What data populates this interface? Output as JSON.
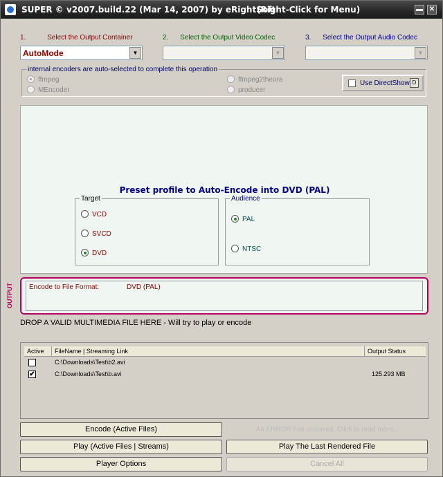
{
  "window": {
    "title": "SUPER © v2007.build.22 (Mar 14, 2007) by eRightSoft",
    "hint": "(Right-Click for Menu)"
  },
  "steps": [
    {
      "num": "1.",
      "label": "Select the Output Container",
      "color": "#8b0000"
    },
    {
      "num": "2.",
      "label": "Select the Output Video Codec",
      "color": "#006400"
    },
    {
      "num": "3.",
      "label": "Select the Output Audio Codec",
      "color": "#0000a0"
    }
  ],
  "containers": {
    "container_value": "AutoMode",
    "video_value": "",
    "audio_value": ""
  },
  "encoders": {
    "legend": "internal encoders are auto-selected to complete this operation",
    "options": [
      "ffmpeg",
      "MEncoder",
      "ffmpeg2theora",
      "producer"
    ],
    "selected": "ffmpeg",
    "directshow_label": "Use DirectShow"
  },
  "preset": {
    "title": "Preset profile to Auto-Encode into DVD  (PAL)",
    "target_legend": "Target",
    "targets": [
      "VCD",
      "SVCD",
      "DVD"
    ],
    "target_selected": "DVD",
    "audience_legend": "Audience",
    "audiences": [
      "PAL",
      "NTSC"
    ],
    "audience_selected": "PAL"
  },
  "output": {
    "vertical_label": "OUTPUT",
    "format_label": "Encode to File Format:",
    "format_value": "DVD  (PAL)"
  },
  "drop_hint": "DROP A VALID MULTIMEDIA FILE HERE - Will try to play or encode",
  "file_list": {
    "headers": [
      "Active",
      "FileName  |  Streaming Link",
      "Output Status"
    ],
    "rows": [
      {
        "active": false,
        "file": "C:\\Downloads\\Test\\b2.avi",
        "status": ""
      },
      {
        "active": true,
        "file": "C:\\Downloads\\Test\\b.avi",
        "status": "125.293 MB"
      }
    ]
  },
  "buttons": {
    "encode": "Encode (Active Files)",
    "error": "An ERROR has occurred. Click to read more...",
    "play": "Play (Active Files | Streams)",
    "play_last": "Play The Last Rendered File",
    "player_options": "Player Options",
    "cancel_all": "Cancel All"
  },
  "check_mark": "✔",
  "icons": {
    "app": "super-app-icon",
    "minimize": "minimize-icon",
    "close": "close-icon",
    "dropdown": "chevron-down-icon"
  }
}
